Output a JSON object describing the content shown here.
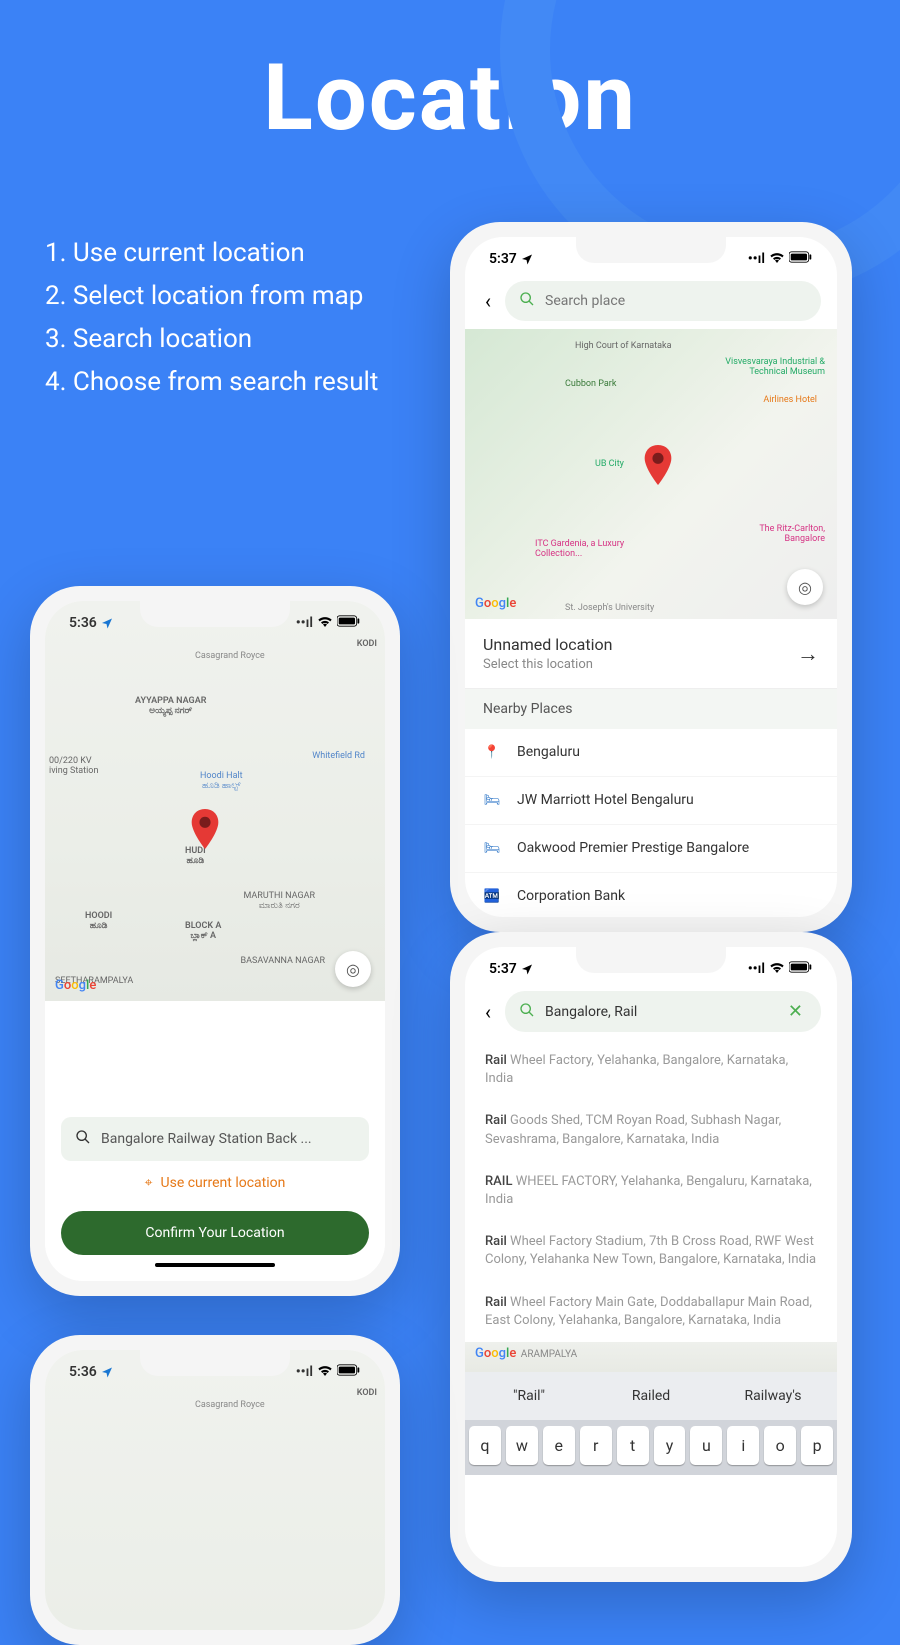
{
  "hero": {
    "title": "Location"
  },
  "instructions": [
    "1. Use current location",
    "2. Select location from map",
    "3. Search location",
    "4. Choose from search result"
  ],
  "status": {
    "time": "5:37"
  },
  "phone1": {
    "search_placeholder": "Search place",
    "map_labels": {
      "court": "High Court of Karnataka",
      "museum": "Visvesvaraya Industrial & Technical Museum",
      "airlines": "Airlines Hotel",
      "park": "Cubbon Park",
      "ub": "UB City",
      "ritz": "The Ritz-Carlton, Bangalore",
      "itc": "ITC Gardenia, a Luxury Collection...",
      "sju": "St. Joseph's University"
    },
    "selected": {
      "title": "Unnamed location",
      "subtitle": "Select this location"
    },
    "nearby_header": "Nearby Places",
    "nearby": [
      {
        "name": "Bengaluru",
        "icon": "📍",
        "color": "#e53935"
      },
      {
        "name": "JW Marriott Hotel Bengaluru",
        "icon": "🛏",
        "color": "#1565c0"
      },
      {
        "name": "Oakwood Premier Prestige Bangalore",
        "icon": "🛏",
        "color": "#1565c0"
      },
      {
        "name": "Corporation Bank",
        "icon": "🏧",
        "color": "#1565c0"
      }
    ]
  },
  "phone2": {
    "status_time": "5:36",
    "map_labels": {
      "casagrand": "Casagrand Royce",
      "kodi": "KODI",
      "ayyappa": "AYYAPPA NAGAR",
      "ayyappa_kn": "ಅಯ್ಯಪ್ಪ ನಗರ್",
      "driving": "00/220 KV iving Station",
      "whitefield": "Whitefield Rd",
      "hoodi_halt": "Hoodi Halt",
      "hoodi_halt_kn": "ಹೂಡಿ ಹಾಲ್ಟ್",
      "hudi": "HUDI",
      "hudi_kn": "ಹೂಡಿ",
      "maruthi": "MARUTHI NAGAR",
      "maruthi_kn": "ಮಾರುತಿ ನಗರ",
      "hoodi": "HOODI",
      "hoodi_kn": "ಹೂಡಿ",
      "blocka": "BLOCK A",
      "blocka_kn": "ಬ್ಲಾಕ್ A",
      "basavanna": "BASAVANNA NAGAR",
      "seetha": "SEETHARAMPALYA"
    },
    "search_text": "Bangalore Railway Station Back ...",
    "use_current": "Use current location",
    "confirm": "Confirm Your Location"
  },
  "phone3": {
    "search_value": "Bangalore, Rail",
    "results": [
      {
        "hl": "Rail",
        "rest": " Wheel Factory, Yelahanka, Bangalore, Karnataka, India"
      },
      {
        "hl": "Rail",
        "rest": " Goods Shed, TCM Royan Road, Subhash Nagar, Sevashrama, Bangalore, Karnataka, India"
      },
      {
        "hl": "RAIL",
        "rest": " WHEEL FACTORY, Yelahanka, Bengaluru, Karnataka, India"
      },
      {
        "hl": "Rail",
        "rest": " Wheel Factory Stadium, 7th B Cross Road, RWF West Colony, Yelahanka New Town, Bangalore, Karnataka, India"
      },
      {
        "hl": "Rail",
        "rest": " Wheel Factory Main Gate, Doddaballapur Main Road, East Colony, Yelahanka, Bangalore, Karnataka, India"
      }
    ],
    "map_peek": "ARAMPALYA",
    "suggestions": [
      "\"Rail\"",
      "Railed",
      "Railway's"
    ],
    "keys": [
      "q",
      "w",
      "e",
      "r",
      "t",
      "y",
      "u",
      "i",
      "o",
      "p"
    ]
  }
}
